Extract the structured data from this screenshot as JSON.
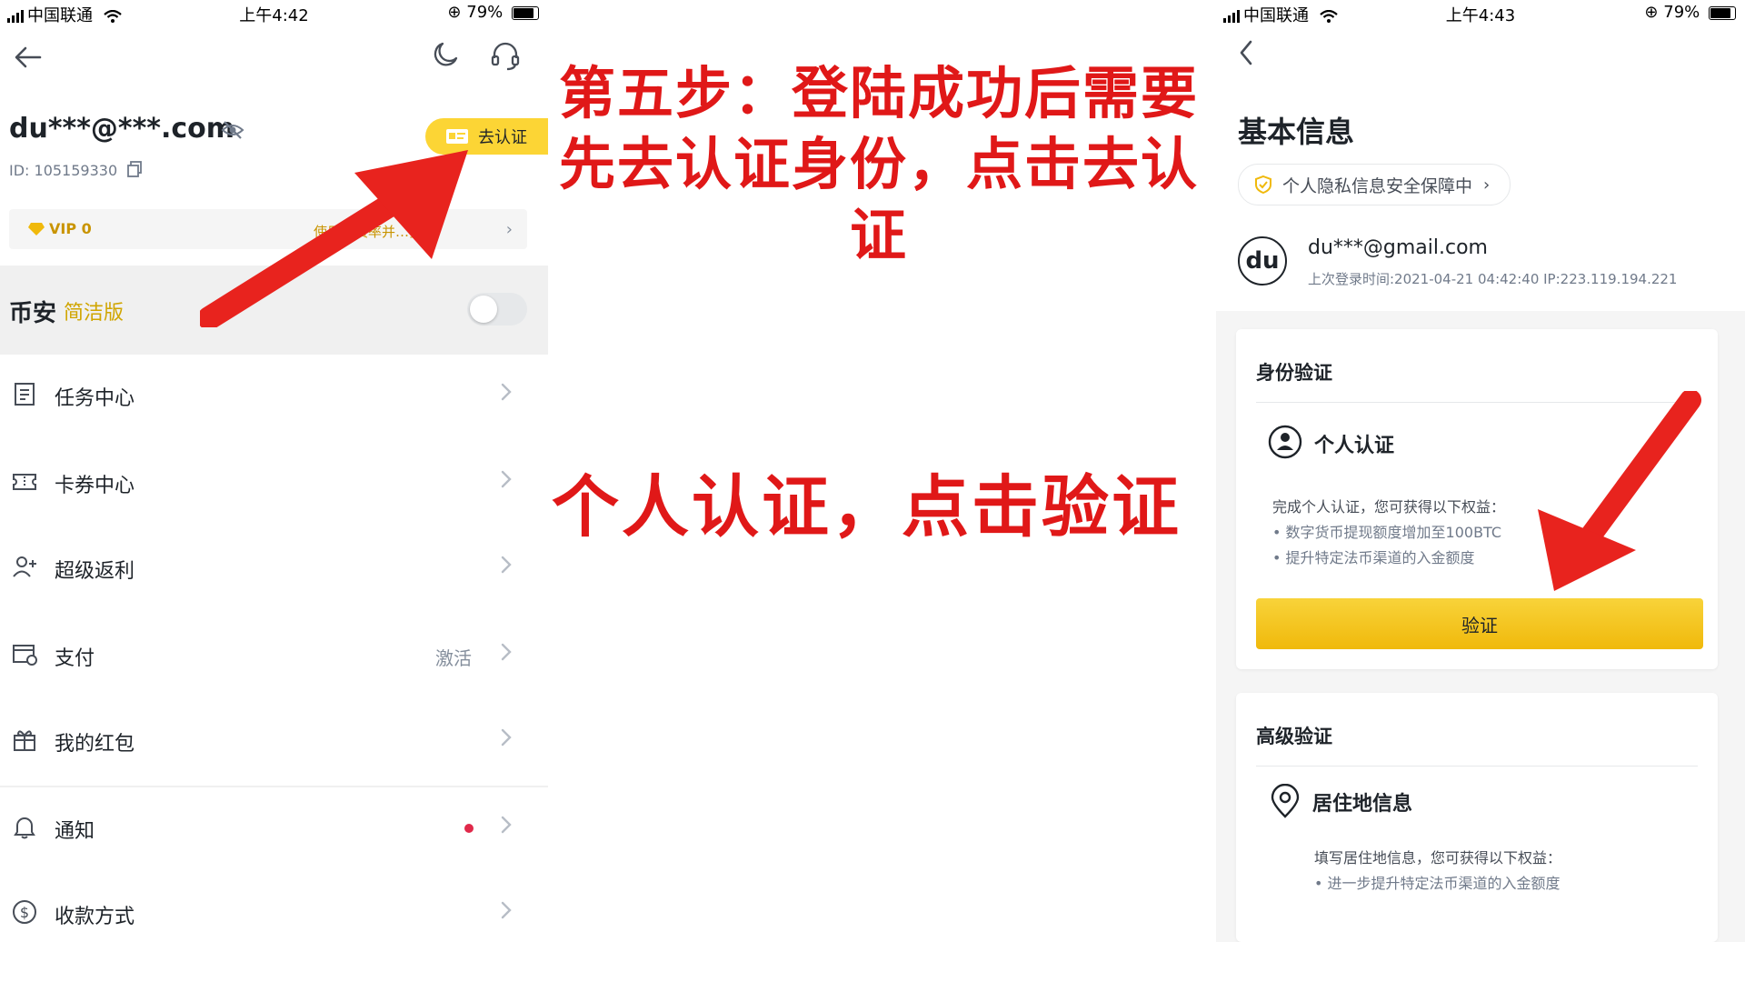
{
  "left_phone": {
    "status": {
      "carrier": "中国联通",
      "time": "上午4:42",
      "battery": "79%"
    },
    "header": {
      "back_icon": "arrow-left-icon",
      "theme_icon": "moon-icon",
      "support_icon": "headset-icon"
    },
    "account": {
      "email": "du***@***.com",
      "uid": "ID: 105159330",
      "verify_button": "去认证"
    },
    "vip": {
      "level": "VIP 0",
      "desc": "使用…费率并…折扣"
    },
    "lite_mode": {
      "title": "币安",
      "subtitle": "简洁版",
      "enabled": false
    },
    "menu": [
      {
        "label": "任务中心",
        "icon": "task-list-icon",
        "extra": ""
      },
      {
        "label": "卡券中心",
        "icon": "ticket-icon",
        "extra": ""
      },
      {
        "label": "超级返利",
        "icon": "add-user-icon",
        "extra": ""
      },
      {
        "label": "支付",
        "icon": "payment-icon",
        "extra": "激活"
      },
      {
        "label": "我的红包",
        "icon": "gift-icon",
        "extra": ""
      },
      {
        "label": "通知",
        "icon": "bell-icon",
        "extra": ""
      },
      {
        "label": "收款方式",
        "icon": "dollar-circle-icon",
        "extra": ""
      }
    ],
    "colors": {
      "accent": "#fcd535",
      "notify_dot": "#e0294a"
    }
  },
  "annotations": {
    "step": "第五步：登陆成功后需要先去认证身份，点击去认证",
    "step_lines": [
      "第五步：登陆成功后需要",
      "先去认证身份，点击去认",
      "证"
    ],
    "personal": "个人认证，点击验证",
    "color": "#e01818"
  },
  "right_phone": {
    "status": {
      "carrier": "中国联通",
      "time": "上午4:43",
      "battery": "79%"
    },
    "title": "基本信息",
    "privacy_pill": "个人隐私信息安全保障中",
    "profile": {
      "avatar_text": "du",
      "email": "du***@gmail.com",
      "last_login": "上次登录时间:2021-04-21 04:42:40  IP:223.119.194.221"
    },
    "identity_card": {
      "heading": "身份验证",
      "item_title": "个人认证",
      "benefit_intro": "完成个人认证，您可获得以下权益：",
      "benefits": [
        "• 数字货币提现额度增加至100BTC",
        "• 提升特定法币渠道的入金额度"
      ],
      "button": "验证"
    },
    "advanced_card": {
      "heading": "高级验证",
      "item_title": "居住地信息",
      "benefit_intro": "填写居住地信息，您可获得以下权益：",
      "benefits": [
        "• 进一步提升特定法币渠道的入金额度"
      ]
    }
  }
}
